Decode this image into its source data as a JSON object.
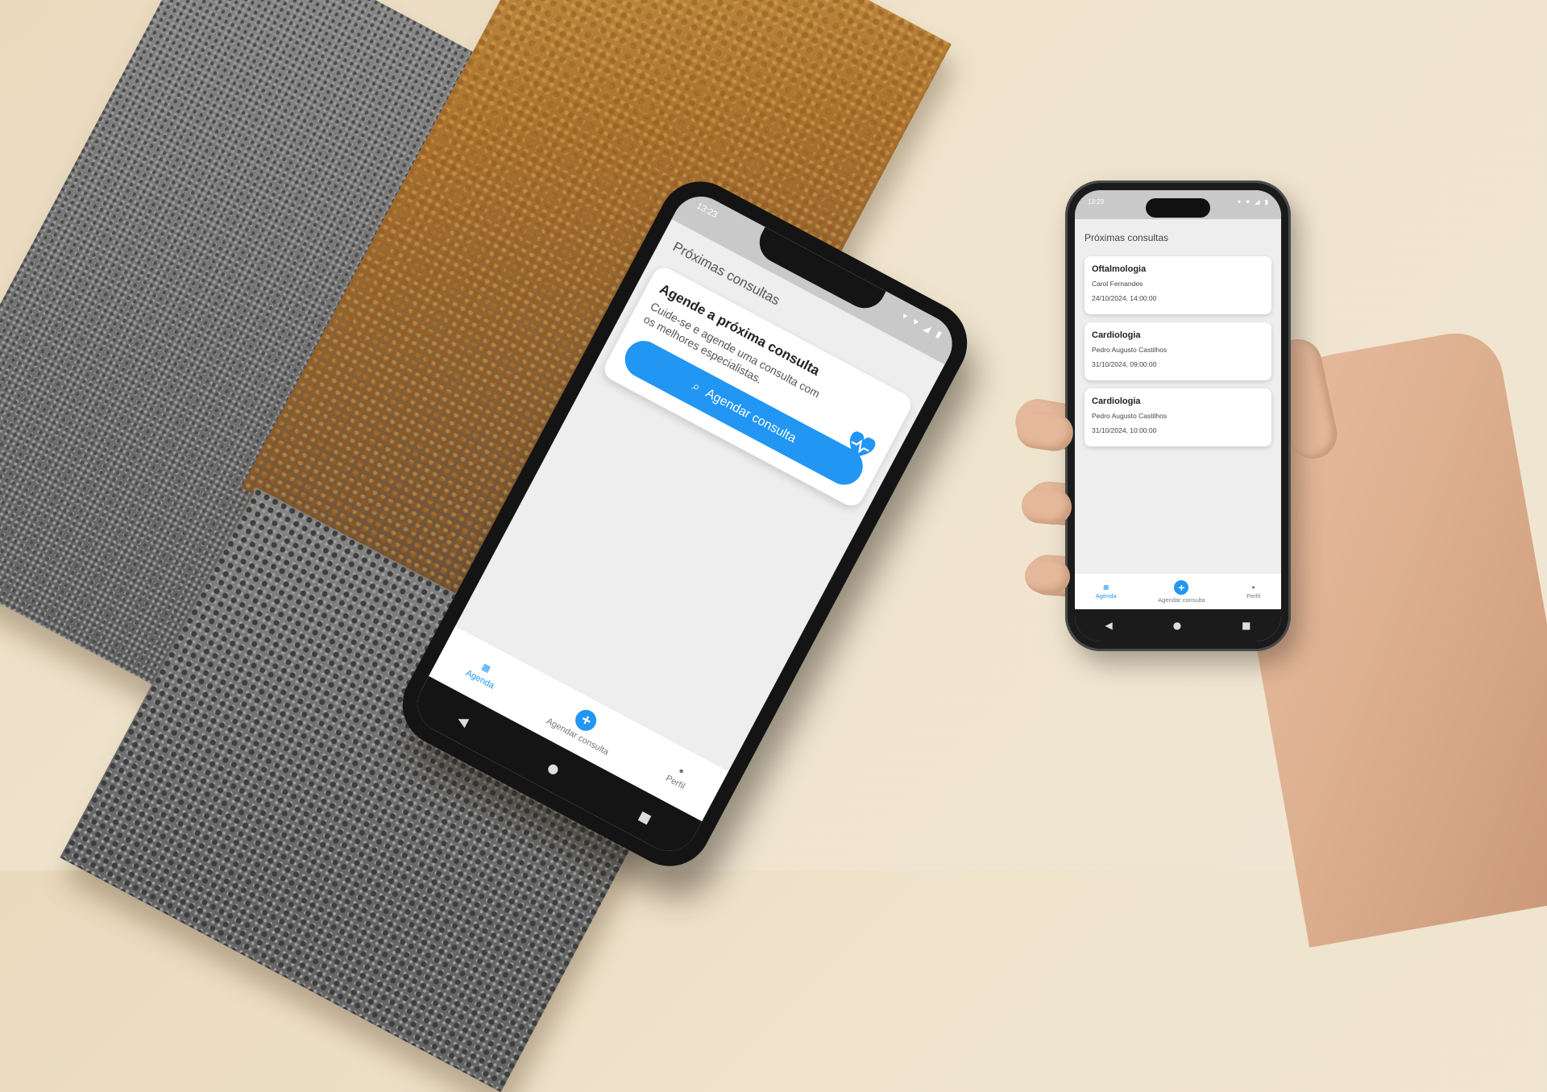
{
  "tilted_phone": {
    "status_time": "13:23",
    "status_icons": "▾ ♥ ◢ ▮",
    "screen_title": "Próximas consultas",
    "promo": {
      "title": "Agende a próxima consulta",
      "subtitle": "Cuide-se e agende uma consulta com os melhores especialistas.",
      "button_label": "Agendar consulta",
      "button_icon": "search-icon",
      "illustration_icon": "heart-pulse-icon"
    },
    "nav": [
      {
        "label": "Agenda",
        "icon": "calendar-icon",
        "active": true
      },
      {
        "label": "Agendar consulta",
        "icon": "plus-circle-icon",
        "active": false
      },
      {
        "label": "Perfil",
        "icon": "person-icon",
        "active": false
      }
    ],
    "system_nav": [
      "◀",
      "●",
      "■"
    ]
  },
  "upright_phone": {
    "status_time": "13:23",
    "status_icons": "▾ ♥ ◢ ▮",
    "screen_title": "Próximas consultas",
    "appointments": [
      {
        "specialty": "Oftalmologia",
        "doctor": "Carol Fernandes",
        "datetime": "24/10/2024, 14:00:00"
      },
      {
        "specialty": "Cardiologia",
        "doctor": "Pedro Augusto Castilhos",
        "datetime": "31/10/2024, 09:00:00"
      },
      {
        "specialty": "Cardiologia",
        "doctor": "Pedro Augusto Castilhos",
        "datetime": "31/10/2024, 10:00:00"
      }
    ],
    "nav": [
      {
        "label": "Agenda",
        "icon": "calendar-icon",
        "active": true
      },
      {
        "label": "Agendar consulta",
        "icon": "plus-circle-icon",
        "active": false
      },
      {
        "label": "Perfil",
        "icon": "person-icon",
        "active": false
      }
    ],
    "system_nav": [
      "◀",
      "●",
      "■"
    ]
  },
  "colors": {
    "accent": "#2196f3",
    "screen_bg": "#eeeeee",
    "card_bg": "#ffffff",
    "backdrop": "#efe3cc"
  }
}
